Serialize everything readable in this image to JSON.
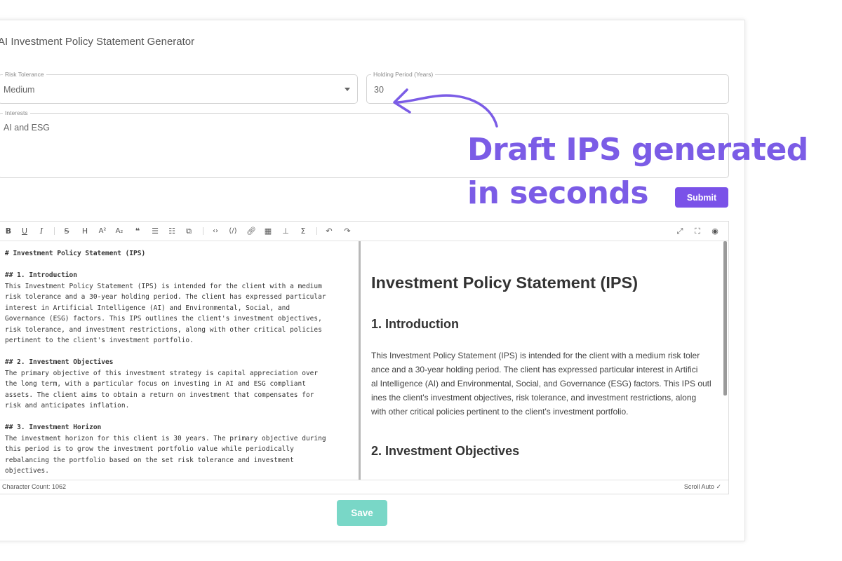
{
  "app": {
    "title": "AI Investment Policy Statement Generator"
  },
  "form": {
    "risk_tolerance": {
      "label": "Risk Tolerance",
      "value": "Medium"
    },
    "holding_period": {
      "label": "Holding Period (Years)",
      "value": "30"
    },
    "interests": {
      "label": "Interests",
      "value": "AI and ESG"
    },
    "submit_label": "Submit"
  },
  "callout": {
    "line1": "Draft IPS generated",
    "line2": "in seconds",
    "color": "#7b5ce6"
  },
  "editor": {
    "toolbar_icons": [
      "bold-icon",
      "underline-icon",
      "italic-icon",
      "strikethrough-icon",
      "header-icon",
      "superscript-icon",
      "subscript-icon",
      "quote-icon",
      "unordered-list-icon",
      "ordered-list-icon",
      "checklist-icon",
      "code-icon",
      "inline-code-icon",
      "link-icon",
      "table-icon",
      "mermaid-icon",
      "katex-icon",
      "undo-icon",
      "redo-icon",
      "fullscreen-icon",
      "page-fullscreen-icon",
      "preview-icon"
    ],
    "markdown_lines": [
      "# Investment Policy Statement (IPS)",
      "",
      "## 1. Introduction",
      "This Investment Policy Statement (IPS) is intended for the client with a medium",
      "risk tolerance and a 30-year holding period. The client has expressed particular",
      "interest in Artificial Intelligence (AI) and Environmental, Social, and",
      "Governance (ESG) factors. This IPS outlines the client's investment objectives,",
      "risk tolerance, and investment restrictions, along with other critical policies",
      "pertinent to the client's investment portfolio.",
      "",
      "## 2. Investment Objectives",
      "The primary objective of this investment strategy is capital appreciation over",
      "the long term, with a particular focus on investing in AI and ESG compliant",
      "assets. The client aims to obtain a return on investment that compensates for",
      "risk and anticipates inflation.",
      "",
      "## 3. Investment Horizon",
      "The investment horizon for this client is 30 years. The primary objective during",
      "this period is to grow the investment portfolio value while periodically",
      "rebalancing the portfolio based on the set risk tolerance and investment",
      "objectives."
    ],
    "preview": {
      "h1": "Investment Policy Statement (IPS)",
      "h2_intro": "1. Introduction",
      "intro_lines": [
        "This Investment Policy Statement (IPS) is intended for the client with a medium risk toler",
        "ance and a 30-year holding period. The client has expressed particular interest in Artifici",
        "al Intelligence (AI) and Environmental, Social, and Governance (ESG) factors. This IPS outl",
        "ines the client's investment objectives, risk tolerance, and investment restrictions, along",
        "with other critical policies pertinent to the client's investment portfolio."
      ],
      "h2_objectives": "2. Investment Objectives"
    },
    "character_count": "Character Count: 1062",
    "scroll_auto": "Scroll Auto"
  },
  "save_label": "Save"
}
